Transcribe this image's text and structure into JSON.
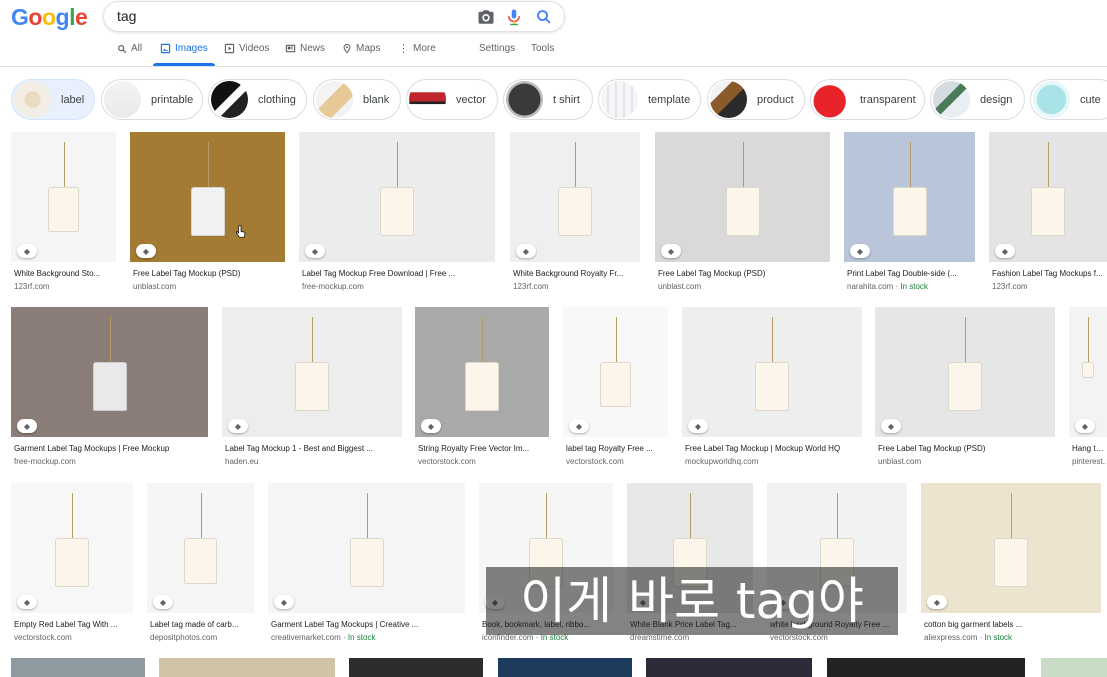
{
  "logo": {
    "letters": [
      {
        "ch": "G",
        "color": "#4285f4"
      },
      {
        "ch": "o",
        "color": "#ea4335"
      },
      {
        "ch": "o",
        "color": "#fbbc05"
      },
      {
        "ch": "g",
        "color": "#4285f4"
      },
      {
        "ch": "l",
        "color": "#34a853"
      },
      {
        "ch": "e",
        "color": "#ea4335"
      }
    ]
  },
  "search": {
    "query": "tag"
  },
  "tabs": {
    "all": "All",
    "images": "Images",
    "videos": "Videos",
    "news": "News",
    "maps": "Maps",
    "more": "More",
    "settings": "Settings",
    "tools": "Tools"
  },
  "chips": [
    "label",
    "printable",
    "clothing",
    "blank",
    "vector",
    "t shirt",
    "template",
    "product",
    "transparent",
    "design",
    "cute"
  ],
  "results_row1": [
    {
      "title": "White Background Sto...",
      "source": "123rf.com",
      "in_stock": ""
    },
    {
      "title": "Free Label Tag Mockup (PSD)",
      "source": "unblast.com",
      "in_stock": ""
    },
    {
      "title": "Label Tag Mockup Free Download | Free ...",
      "source": "free-mockup.com",
      "in_stock": ""
    },
    {
      "title": "White Background Royalty Fr...",
      "source": "123rf.com",
      "in_stock": ""
    },
    {
      "title": "Free Label Tag Mockup (PSD)",
      "source": "unblast.com",
      "in_stock": ""
    },
    {
      "title": "Print Label Tag Double-side (...",
      "source": "narahita.com · ",
      "in_stock": "In stock"
    },
    {
      "title": "Fashion Label Tag Mockups f...",
      "source": "123rf.com",
      "in_stock": ""
    }
  ],
  "results_row2": [
    {
      "title": "Garment Label Tag Mockups | Free Mockup",
      "source": "free-mockup.com",
      "in_stock": ""
    },
    {
      "title": "Label Tag Mockup 1 - Best and Biggest ...",
      "source": "haden.eu",
      "in_stock": ""
    },
    {
      "title": "String Royalty Free Vector Im...",
      "source": "vectorstock.com",
      "in_stock": ""
    },
    {
      "title": "label tag Royalty Free ...",
      "source": "vectorstock.com",
      "in_stock": ""
    },
    {
      "title": "Free Label Tag Mockup | Mockup World HQ",
      "source": "mockupworldhq.com",
      "in_stock": ""
    },
    {
      "title": "Free Label Tag Mockup (PSD)",
      "source": "unblast.com",
      "in_stock": ""
    },
    {
      "title": "Hang tag...",
      "source": "pinterest...",
      "in_stock": ""
    }
  ],
  "results_row3": [
    {
      "title": "Empty Red Label Tag With ...",
      "source": "vectorstock.com",
      "in_stock": ""
    },
    {
      "title": "Label tag made of carb...",
      "source": "depositphotos.com",
      "in_stock": ""
    },
    {
      "title": "Garment Label Tag Mockups | Creative ...",
      "source": "creativemarket.com · ",
      "in_stock": "In stock"
    },
    {
      "title": "Book, bookmark, label, ribbo...",
      "source": "iconfinder.com · ",
      "in_stock": "In stock"
    },
    {
      "title": "White Blank Price Label Tag...",
      "source": "dreamstime.com",
      "in_stock": ""
    },
    {
      "title": "white background Royalty Free ...",
      "source": "vectorstock.com",
      "in_stock": ""
    },
    {
      "title": "cotton big garment labels ...",
      "source": "aliexpress.com · ",
      "in_stock": "In stock"
    }
  ],
  "subtitle": "이게 바로 tag야",
  "colors": {
    "accent": "#1a73e8",
    "in_stock": "#188038",
    "chip_selected": "#e8f0fe"
  }
}
